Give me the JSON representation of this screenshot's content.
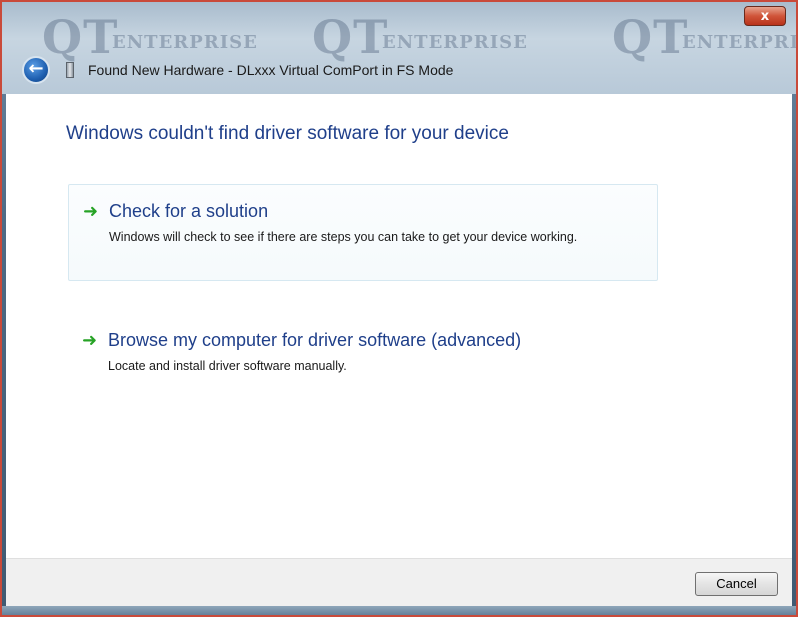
{
  "window": {
    "title": "Found New Hardware - DLxxx Virtual ComPort in FS Mode",
    "close_glyph": "x",
    "watermark_big": "QT",
    "watermark_small": "ENTERPRISE"
  },
  "content": {
    "headline": "Windows couldn't find driver software for your device",
    "options": [
      {
        "icon": "green-arrow-icon",
        "title": "Check for a solution",
        "description": "Windows will check to see if there are steps you can take to get your device working."
      },
      {
        "icon": "green-arrow-icon",
        "title": "Browse my computer for driver software (advanced)",
        "description": "Locate and install driver software manually."
      }
    ]
  },
  "footer": {
    "cancel_label": "Cancel"
  },
  "colors": {
    "accent_text": "#1f3f8a",
    "arrow_green": "#27a326",
    "close_red": "#c94a3a"
  }
}
